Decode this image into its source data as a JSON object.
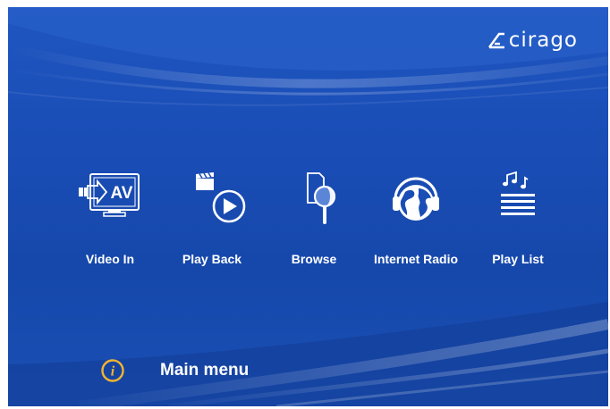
{
  "brand": {
    "name": "cirago"
  },
  "menu": {
    "items": [
      {
        "id": "video-in",
        "label": "Video In",
        "icon_text": "AV"
      },
      {
        "id": "play-back",
        "label": "Play Back"
      },
      {
        "id": "browse",
        "label": "Browse"
      },
      {
        "id": "internet-radio",
        "label": "Internet Radio"
      },
      {
        "id": "play-list",
        "label": "Play List"
      }
    ]
  },
  "footer": {
    "info_glyph": "i",
    "title": "Main menu"
  },
  "colors": {
    "background": "#1a4db6",
    "text": "#ffffff",
    "info_accent": "#f2b431"
  },
  "icons": [
    "av-input-icon",
    "clapper-play-icon",
    "magnifier-file-icon",
    "globe-headphones-icon",
    "music-list-icon",
    "info-icon"
  ]
}
